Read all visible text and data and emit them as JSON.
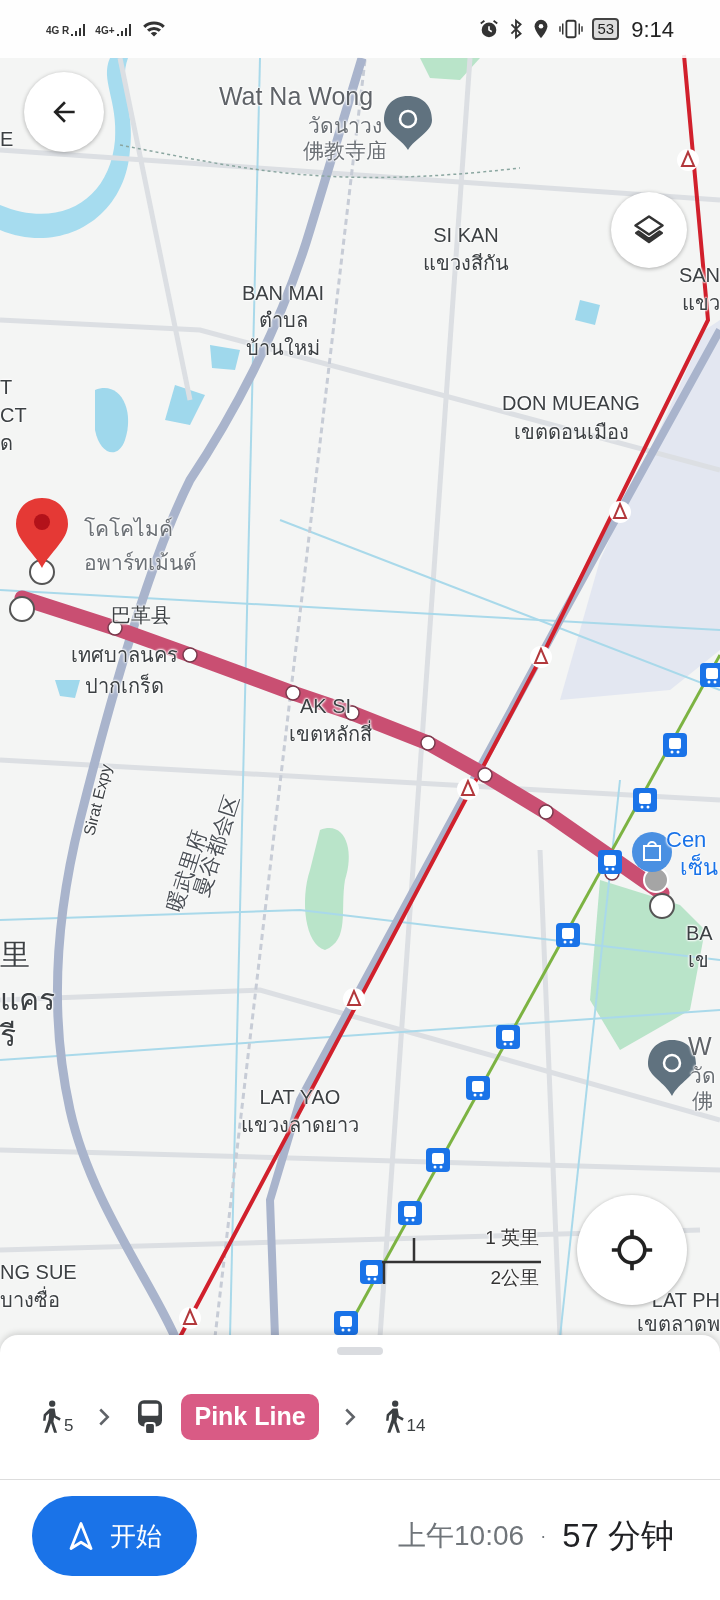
{
  "status_bar": {
    "networks": [
      {
        "label": "4G R"
      },
      {
        "label": "4G+"
      }
    ],
    "battery": "53",
    "time": "9:14"
  },
  "map": {
    "labels": [
      {
        "text": "Wat Na Wong",
        "kind": "poi_title"
      },
      {
        "text": "วัดนาวง",
        "kind": "poi"
      },
      {
        "text": "E",
        "kind": "area"
      },
      {
        "text": "佛教寺庙",
        "kind": "poi"
      },
      {
        "text": "SI KAN",
        "kind": "area"
      },
      {
        "text": "แขวงสีกัน",
        "kind": "area"
      },
      {
        "text": "SAN",
        "kind": "area"
      },
      {
        "text": "BAN MAI",
        "kind": "area"
      },
      {
        "text": "แขว",
        "kind": "area"
      },
      {
        "text": "ตำบล",
        "kind": "area"
      },
      {
        "text": "บ้านใหม่",
        "kind": "area"
      },
      {
        "text": "T",
        "kind": "area"
      },
      {
        "text": "DON MUEANG",
        "kind": "area"
      },
      {
        "text": "CT",
        "kind": "area"
      },
      {
        "text": "เขตดอนเมือง",
        "kind": "area"
      },
      {
        "text": "ด",
        "kind": "area"
      },
      {
        "text": "โคโคไมค์",
        "kind": "poi"
      },
      {
        "text": "อพาร์ทเม้นต์",
        "kind": "poi"
      },
      {
        "text": "巴革县",
        "kind": "area"
      },
      {
        "text": "เทศบาลนคร",
        "kind": "area"
      },
      {
        "text": "ปากเกร็ด",
        "kind": "area"
      },
      {
        "text": "AK SI",
        "kind": "area"
      },
      {
        "text": "เขตหลักสี่",
        "kind": "area"
      },
      {
        "text": "Sirat Expy",
        "kind": "road"
      },
      {
        "text": "暖武里府",
        "kind": "region"
      },
      {
        "text": "曼谷都会区",
        "kind": "region"
      },
      {
        "text": "Cen",
        "kind": "shop"
      },
      {
        "text": "เซ็น",
        "kind": "shop"
      },
      {
        "text": "BA",
        "kind": "area"
      },
      {
        "text": "里",
        "kind": "big"
      },
      {
        "text": "เข",
        "kind": "area"
      },
      {
        "text": "แคร",
        "kind": "big"
      },
      {
        "text": "รี",
        "kind": "big"
      },
      {
        "text": "W",
        "kind": "poi_title"
      },
      {
        "text": "วัด",
        "kind": "poi"
      },
      {
        "text": "LAT YAO",
        "kind": "area"
      },
      {
        "text": "佛",
        "kind": "poi"
      },
      {
        "text": "แขวงลาดยาว",
        "kind": "area"
      },
      {
        "text": "NG SUE",
        "kind": "area"
      },
      {
        "text": "LAT PH",
        "kind": "area"
      },
      {
        "text": "บางซื่อ",
        "kind": "area"
      },
      {
        "text": "เขตลาดพ",
        "kind": "area"
      }
    ],
    "scale": {
      "imperial": "1 英里",
      "metric": "2公里"
    }
  },
  "route_summary": {
    "steps": [
      {
        "kind": "walk",
        "minutes": "5"
      },
      {
        "kind": "transit",
        "line": "Pink Line",
        "color": "#d95b85"
      },
      {
        "kind": "walk",
        "minutes": "14"
      }
    ]
  },
  "footer": {
    "start_button": "开始",
    "arrival": "上午10:06",
    "separator": "·",
    "duration": "57 分钟"
  }
}
